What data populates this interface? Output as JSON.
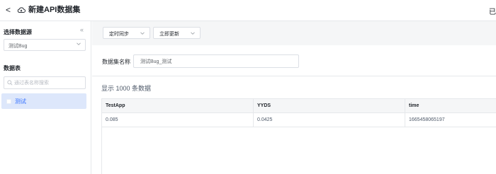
{
  "header": {
    "back_glyph": "<",
    "title": "新建API数据集",
    "right_text": "已"
  },
  "sidebar": {
    "collapse_glyph": "«",
    "datasource_label": "选择数据源",
    "datasource_value": "测试Bug",
    "tables_label": "数据表",
    "search_placeholder": "通过表名称搜索",
    "tables": [
      {
        "label": "测试",
        "selected": true
      }
    ]
  },
  "toolbar": {
    "sync_label": "定时同步",
    "update_label": "立即更新"
  },
  "form": {
    "name_label": "数据集名称",
    "name_value": "测试Bug_测试"
  },
  "preview": {
    "count_text": "显示 1000 条数据",
    "columns": [
      "TestApp",
      "YYDS",
      "time"
    ],
    "rows": [
      [
        "0.085",
        "0.0425",
        "1665458065197"
      ]
    ]
  },
  "colors": {
    "accent": "#3370ff",
    "selected_bg": "#dde7fb",
    "toolbar_bg": "#f5f6f7",
    "border": "#e6e8eb"
  }
}
